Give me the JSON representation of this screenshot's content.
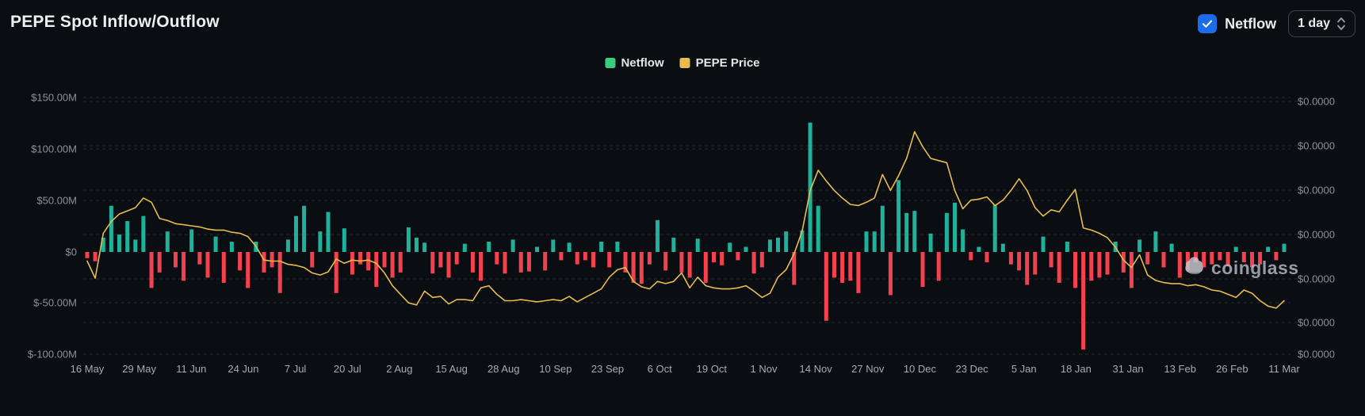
{
  "header": {
    "title": "PEPE Spot Inflow/Outflow",
    "netflow_toggle": {
      "label": "Netflow",
      "checked": true,
      "checkbox_color": "#1b6ce9"
    },
    "interval_select": {
      "value": "1 day"
    }
  },
  "legend": {
    "items": [
      {
        "label": "Netflow",
        "color": "#3bcb7f"
      },
      {
        "label": "PEPE Price",
        "color": "#e7bc4e"
      }
    ]
  },
  "watermark": {
    "text": "coinglass"
  },
  "chart_data": {
    "type": "bar",
    "title": "PEPE Spot Inflow/Outflow",
    "grid": true,
    "legend_position": "top-center",
    "x_axis": {
      "tick_labels": [
        "16 May",
        "29 May",
        "11 Jun",
        "24 Jun",
        "7 Jul",
        "20 Jul",
        "2 Aug",
        "15 Aug",
        "28 Aug",
        "10 Sep",
        "23 Sep",
        "6 Oct",
        "19 Oct",
        "1 Nov",
        "14 Nov",
        "27 Nov",
        "10 Dec",
        "23 Dec",
        "5 Jan",
        "18 Jan",
        "31 Jan",
        "13 Feb",
        "26 Feb",
        "11 Mar"
      ]
    },
    "left_axis": {
      "tick_labels": [
        "$150.00M",
        "$100.00M",
        "$50.00M",
        "$0",
        "$-50.00M",
        "$-100.00M"
      ],
      "ylim_millions": [
        -100,
        150
      ]
    },
    "right_axis": {
      "tick_labels": [
        "$0.0000",
        "$0.0000",
        "$0.0000",
        "$0.0000",
        "$0.0000",
        "$0.0000",
        "$0.0000"
      ]
    },
    "start_label": "16 May",
    "end_label": "11 Mar",
    "sample_interval_days": 2,
    "series": [
      {
        "name": "Netflow",
        "type": "bar",
        "unit": "USD millions",
        "color_positive": "#1fb199",
        "color_negative": "#f4414f",
        "values": [
          -6,
          -9,
          14,
          45,
          17,
          30,
          12,
          35,
          -35,
          -20,
          20,
          -15,
          -28,
          22,
          -12,
          -25,
          15,
          -30,
          10,
          -18,
          -35,
          10,
          -20,
          -15,
          -40,
          12,
          35,
          45,
          -15,
          20,
          39,
          -40,
          23,
          -22,
          -12,
          -18,
          -34,
          -15,
          -25,
          -20,
          24,
          14,
          9,
          -21,
          -15,
          -25,
          -12,
          8,
          -20,
          -28,
          10,
          -12,
          -21,
          12,
          -20,
          -19,
          5,
          -18,
          12,
          -8,
          9,
          -12,
          -8,
          -15,
          10,
          -15,
          10,
          -20,
          -30,
          -31,
          -12,
          31,
          -18,
          14,
          -20,
          -25,
          13,
          -30,
          -10,
          -13,
          9,
          -8,
          5,
          -21,
          -15,
          12,
          14,
          20,
          -32,
          21,
          126,
          45,
          -67,
          -25,
          -30,
          -28,
          -40,
          20,
          20,
          45,
          -42,
          70,
          38,
          40,
          -34,
          18,
          -28,
          38,
          48,
          22,
          -8,
          5,
          -10,
          46,
          8,
          -12,
          -18,
          -32,
          -22,
          15,
          -15,
          -30,
          10,
          -35,
          -95,
          -28,
          -25,
          -22,
          10,
          -20,
          -35,
          12,
          -12,
          20,
          -15,
          8,
          -25,
          -18,
          -10,
          -15,
          -12,
          -8,
          -14,
          5,
          -10,
          -15,
          -12,
          5,
          -8,
          8
        ]
      },
      {
        "name": "PEPE Price",
        "type": "line",
        "unit": "USD",
        "color": "#e7bc4e",
        "values": [
          1.27e-05,
          1.11e-05,
          1.53e-05,
          1.64e-05,
          1.71e-05,
          1.74e-05,
          1.77e-05,
          1.86e-05,
          1.82e-05,
          1.67e-05,
          1.65e-05,
          1.62e-05,
          1.61e-05,
          1.6e-05,
          1.59e-05,
          1.57e-05,
          1.56e-05,
          1.56e-05,
          1.54e-05,
          1.53e-05,
          1.5e-05,
          1.41e-05,
          1.28e-05,
          1.27e-05,
          1.27e-05,
          1.24e-05,
          1.23e-05,
          1.21e-05,
          1.16e-05,
          1.14e-05,
          1.17e-05,
          1.29e-05,
          1.25e-05,
          1.28e-05,
          1.27e-05,
          1.28e-05,
          1.25e-05,
          1.16e-05,
          1.04e-05,
          9.6e-06,
          8.8e-06,
          8.6e-06,
          9.9e-06,
          9.3e-06,
          9.4e-06,
          8.7e-06,
          9.1e-06,
          9.1e-06,
          9e-06,
          1.02e-05,
          1.04e-05,
          9.6e-06,
          9e-06,
          9e-06,
          9.1e-06,
          9e-06,
          8.9e-06,
          9e-06,
          9.1e-06,
          9e-06,
          9.4e-06,
          8.9e-06,
          9.3e-06,
          9.7e-06,
          1.01e-05,
          1.12e-05,
          1.19e-05,
          1.21e-05,
          1.08e-05,
          1.03e-05,
          1.01e-05,
          1.08e-05,
          1.06e-05,
          1.08e-05,
          1.16e-05,
          1.02e-05,
          1.12e-05,
          1.04e-05,
          1.02e-05,
          1.01e-05,
          1.01e-05,
          1.02e-05,
          1.04e-05,
          9.9e-06,
          9.3e-06,
          9.7e-06,
          1.12e-05,
          1.19e-05,
          1.34e-05,
          1.55e-05,
          1.93e-05,
          2.12e-05,
          2.02e-05,
          1.93e-05,
          1.86e-05,
          1.8e-05,
          1.79e-05,
          1.82e-05,
          1.86e-05,
          2.08e-05,
          1.93e-05,
          2.07e-05,
          2.23e-05,
          2.48e-05,
          2.34e-05,
          2.23e-05,
          2.21e-05,
          2.19e-05,
          1.93e-05,
          1.76e-05,
          1.84e-05,
          1.85e-05,
          1.87e-05,
          1.79e-05,
          1.84e-05,
          1.93e-05,
          2.04e-05,
          1.93e-05,
          1.77e-05,
          1.69e-05,
          1.75e-05,
          1.73e-05,
          1.84e-05,
          1.94e-05,
          1.58e-05,
          1.56e-05,
          1.53e-05,
          1.49e-05,
          1.4e-05,
          1.28e-05,
          1.21e-05,
          1.33e-05,
          1.14e-05,
          1.09e-05,
          1.07e-05,
          1.06e-05,
          1.06e-05,
          1.04e-05,
          1.05e-05,
          1.03e-05,
          1e-05,
          9.9e-06,
          9.6e-06,
          9.3e-06,
          1e-05,
          9.7e-06,
          9e-06,
          8.5e-06,
          8.3e-06,
          9e-06
        ]
      }
    ]
  }
}
